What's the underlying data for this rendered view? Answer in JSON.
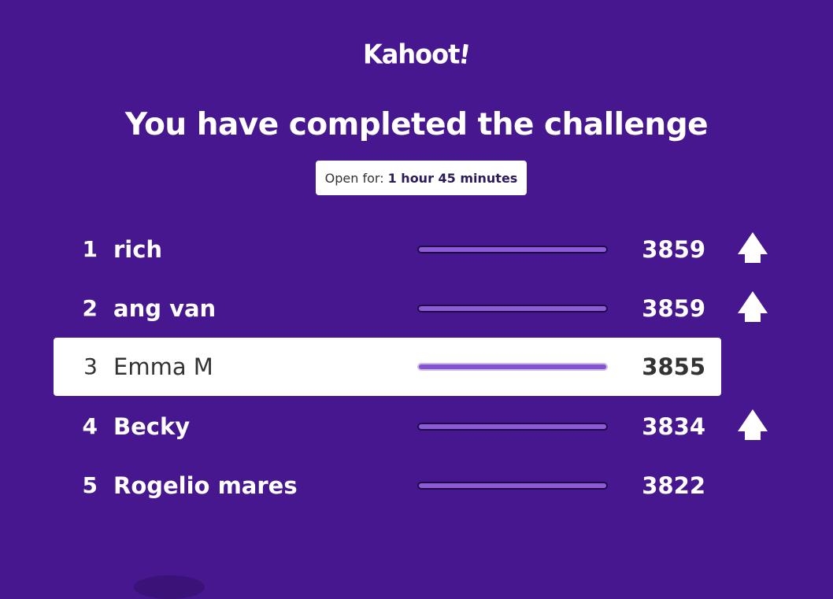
{
  "logo": {
    "text": "Kahoot",
    "mark": "!"
  },
  "title": "You have completed the challenge",
  "open_for": {
    "label": "Open for:",
    "value": "1 hour 45 minutes"
  },
  "leaderboard": [
    {
      "rank": "1",
      "name": "rich",
      "score": "3859",
      "progress": 1.0,
      "moved_up": true,
      "highlighted": false
    },
    {
      "rank": "2",
      "name": "ang van",
      "score": "3859",
      "progress": 1.0,
      "moved_up": true,
      "highlighted": false
    },
    {
      "rank": "3",
      "name": "Emma M",
      "score": "3855",
      "progress": 1.0,
      "moved_up": false,
      "highlighted": true
    },
    {
      "rank": "4",
      "name": "Becky",
      "score": "3834",
      "progress": 1.0,
      "moved_up": true,
      "highlighted": false
    },
    {
      "rank": "5",
      "name": "Rogelio mares",
      "score": "3822",
      "progress": 1.0,
      "moved_up": false,
      "highlighted": false
    }
  ],
  "icons": {
    "move_up": "arrow-up-icon"
  },
  "colors": {
    "background": "#46178f",
    "highlight_row": "#ffffff",
    "bar_fill": "#8e5bd6"
  }
}
